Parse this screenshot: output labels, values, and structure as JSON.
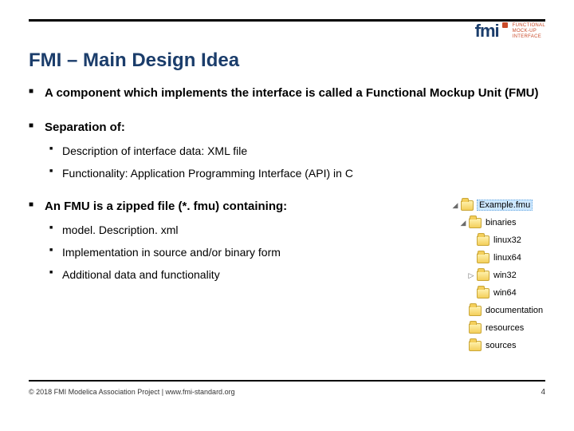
{
  "logo": {
    "mark": "fmi",
    "line1": "FUNCTIONAL",
    "line2": "MOCK-UP",
    "line3": "INTERFACE"
  },
  "title": "FMI – Main Design Idea",
  "bullets": {
    "b1": "A component which implements the interface is called a Functional Mockup Unit (FMU)",
    "b2": "Separation of:",
    "b2_1": "Description of interface data: XML file",
    "b2_2": "Functionality: Application Programming Interface (API) in C",
    "b3": "An FMU is a zipped file (*. fmu) containing:",
    "b3_1": "model. Description. xml",
    "b3_2": "Implementation in source and/or binary form",
    "b3_3": "Additional data and functionality"
  },
  "tree": {
    "n0": "Example.fmu",
    "n1": "binaries",
    "n1_1": "linux32",
    "n1_2": "linux64",
    "n1_3": "win32",
    "n1_4": "win64",
    "n2": "documentation",
    "n3": "resources",
    "n4": "sources"
  },
  "footer": "© 2018 FMI Modelica Association Project | www.fmi-standard.org",
  "page": "4"
}
